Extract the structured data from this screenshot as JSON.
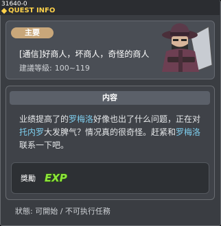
{
  "window": {
    "quest_id": "31640-0",
    "title": "QUEST INFO"
  },
  "quest": {
    "type_label": "主要",
    "name": "[通信]好商人，坏商人，奇怪的商人",
    "level_label": "建議等級:",
    "level_range": "100~119"
  },
  "content": {
    "header": "内容",
    "segments": [
      {
        "text": "业绩提高了的"
      },
      {
        "text": "罗梅洛",
        "hl": true
      },
      {
        "text": "好像也出了什么问题，正在对"
      },
      {
        "text": "托内罗",
        "hl": true
      },
      {
        "text": "大发脾气？情况真的很奇怪。赶紧和"
      },
      {
        "text": "罗梅洛",
        "hl": true
      },
      {
        "text": "联系一下吧。"
      }
    ]
  },
  "reward": {
    "label": "獎勵",
    "exp_text": "EXP"
  },
  "status": {
    "text": "狀態: 可開始 / 不可执行任務"
  },
  "colors": {
    "highlight": "#7fd0f0",
    "title": "#ffd24a",
    "exp_green": "#8ee63a"
  },
  "npc": {
    "icon": "merchant-npc-portrait"
  }
}
